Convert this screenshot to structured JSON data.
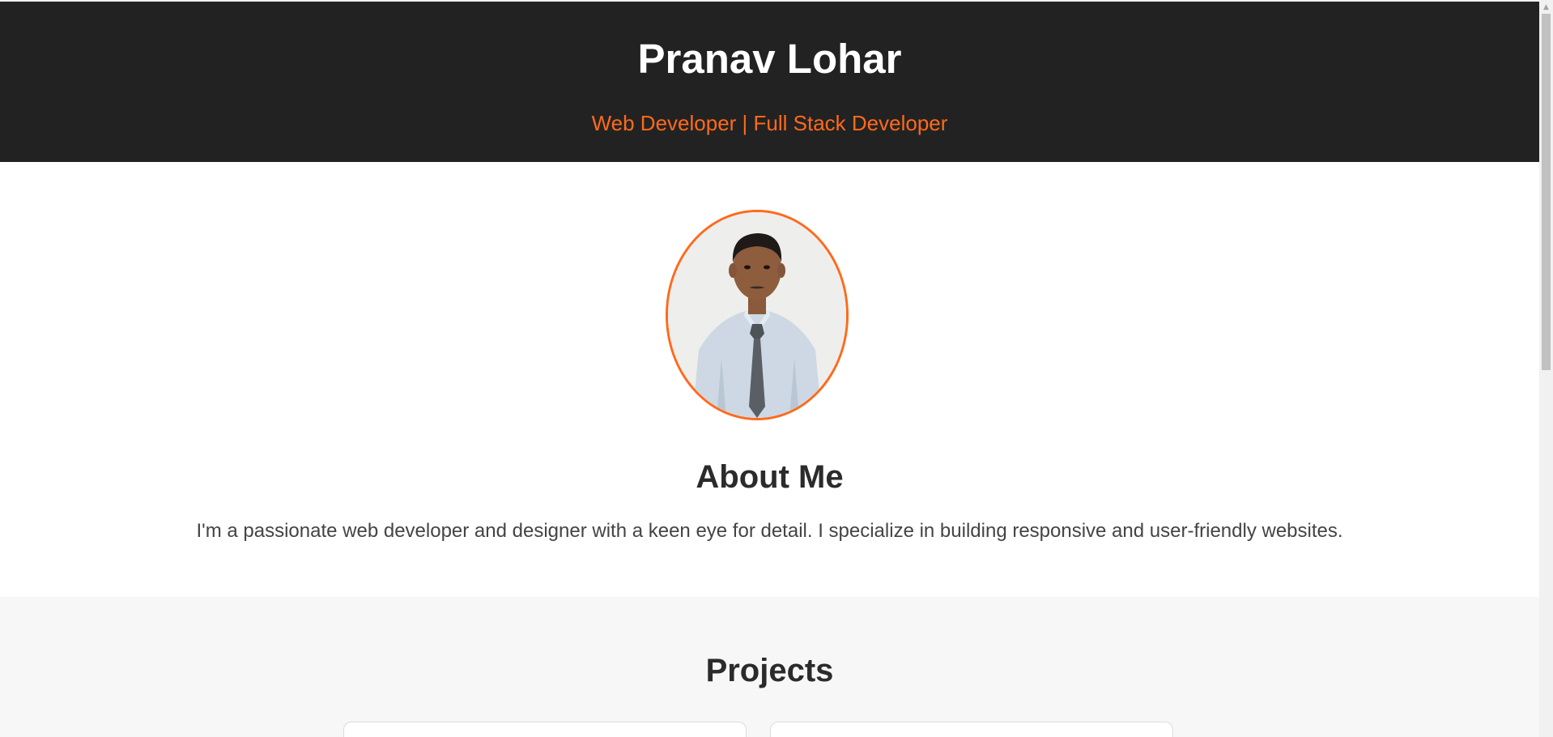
{
  "header": {
    "name": "Pranav Lohar",
    "tagline": "Web Developer | Full Stack Developer"
  },
  "about": {
    "photo_icon": "profile-photo",
    "heading": "About Me",
    "text": "I'm a passionate web developer and designer with a keen eye for detail. I specialize in building responsive and user-friendly websites."
  },
  "projects": {
    "heading": "Projects"
  },
  "scrollbar": {
    "up_arrow": "▲"
  },
  "colors": {
    "header_bg": "#222222",
    "accent": "#ff6a1a",
    "section_alt_bg": "#f7f7f7"
  }
}
